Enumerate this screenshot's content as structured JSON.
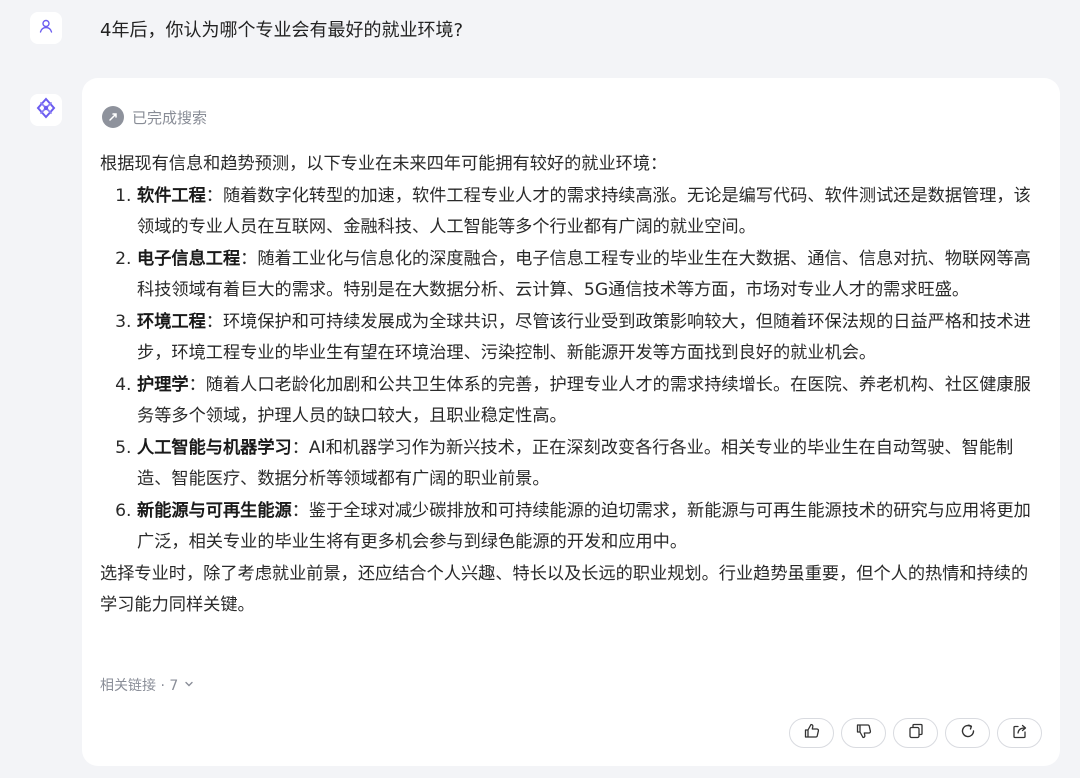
{
  "user": {
    "avatar_icon": "user-icon",
    "question": "4年后，你认为哪个专业会有最好的就业环境?"
  },
  "assistant": {
    "avatar_icon": "bot-logo-icon",
    "search_status": "已完成搜索",
    "intro": "根据现有信息和趋势预测，以下专业在未来四年可能拥有较好的就业环境：",
    "items": [
      {
        "title": "软件工程",
        "text": "：随着数字化转型的加速，软件工程专业人才的需求持续高涨。无论是编写代码、软件测试还是数据管理，该领域的专业人员在互联网、金融科技、人工智能等多个行业都有广阔的就业空间。"
      },
      {
        "title": "电子信息工程",
        "text": "：随着工业化与信息化的深度融合，电子信息工程专业的毕业生在大数据、通信、信息对抗、物联网等高科技领域有着巨大的需求。特别是在大数据分析、云计算、5G通信技术等方面，市场对专业人才的需求旺盛。"
      },
      {
        "title": "环境工程",
        "text": "：环境保护和可持续发展成为全球共识，尽管该行业受到政策影响较大，但随着环保法规的日益严格和技术进步，环境工程专业的毕业生有望在环境治理、污染控制、新能源开发等方面找到良好的就业机会。"
      },
      {
        "title": "护理学",
        "text": "：随着人口老龄化加剧和公共卫生体系的完善，护理专业人才的需求持续增长。在医院、养老机构、社区健康服务等多个领域，护理人员的缺口较大，且职业稳定性高。"
      },
      {
        "title": "人工智能与机器学习",
        "text": "：AI和机器学习作为新兴技术，正在深刻改变各行各业。相关专业的毕业生在自动驾驶、智能制造、智能医疗、数据分析等领域都有广阔的职业前景。"
      },
      {
        "title": "新能源与可再生能源",
        "text": "：鉴于全球对减少碳排放和可持续能源的迫切需求，新能源与可再生能源技术的研究与应用将更加广泛，相关专业的毕业生将有更多机会参与到绿色能源的开发和应用中。"
      }
    ],
    "conclusion": "选择专业时，除了考虑就业前景，还应结合个人兴趣、特长以及长远的职业规划。行业趋势虽重要，但个人的热情和持续的学习能力同样关键。",
    "related_links": "相关链接 · 7",
    "actions": [
      {
        "name": "like-button",
        "icon": "thumbs-up-icon"
      },
      {
        "name": "dislike-button",
        "icon": "thumbs-down-icon"
      },
      {
        "name": "copy-button",
        "icon": "copy-icon"
      },
      {
        "name": "regenerate-button",
        "icon": "refresh-icon"
      },
      {
        "name": "share-button",
        "icon": "share-icon"
      }
    ]
  },
  "colors": {
    "background": "#f3f4f7",
    "card": "#ffffff",
    "accent": "#6b5cf0",
    "muted_text": "#888c96"
  }
}
